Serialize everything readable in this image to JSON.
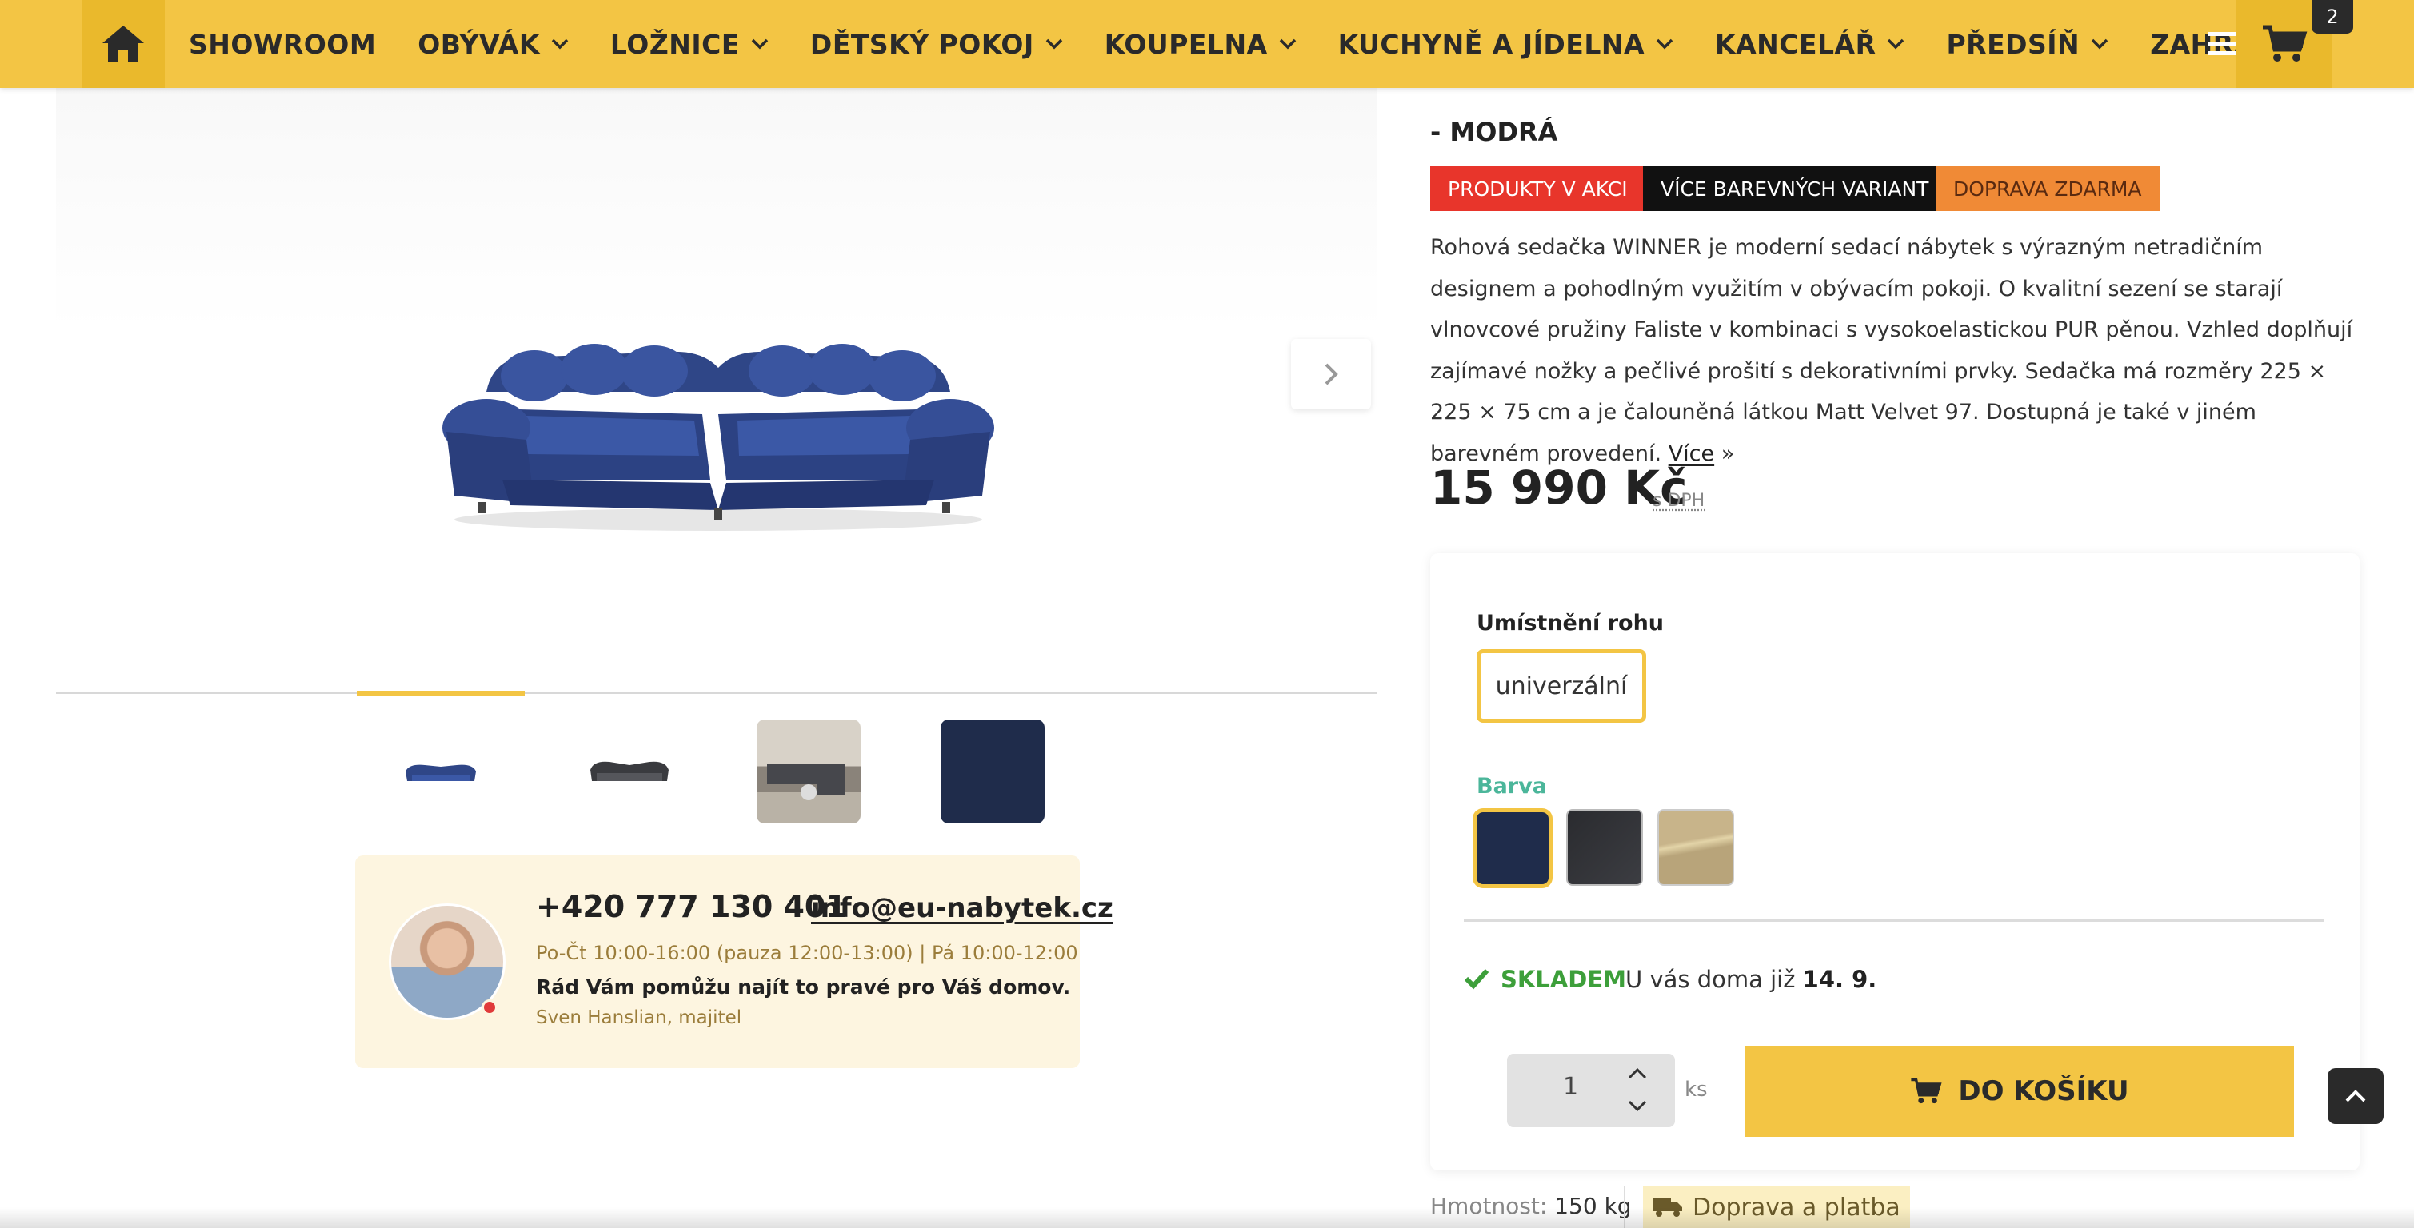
{
  "nav": {
    "items": [
      {
        "label": "SHOWROOM",
        "dropdown": false
      },
      {
        "label": "OBÝVÁK",
        "dropdown": true
      },
      {
        "label": "LOŽNICE",
        "dropdown": true
      },
      {
        "label": "DĚTSKÝ POKOJ",
        "dropdown": true
      },
      {
        "label": "KOUPELNA",
        "dropdown": true
      },
      {
        "label": "KUCHYNĚ A JÍDELNA",
        "dropdown": true
      },
      {
        "label": "KANCELÁŘ",
        "dropdown": true
      },
      {
        "label": "PŘEDSÍŇ",
        "dropdown": true
      },
      {
        "label": "ZAHRADA",
        "dropdown": true
      }
    ],
    "cart_count": "2"
  },
  "product": {
    "subtitle": "- MODRÁ",
    "tags": [
      {
        "label": "PRODUKTY V AKCI",
        "color": "#e8352b"
      },
      {
        "label": "VÍCE BAREVNÝCH VARIANT",
        "color": "#111111"
      },
      {
        "label": "DOPRAVA ZDARMA",
        "color": "#f08a36"
      }
    ],
    "description": "Rohová sedačka WINNER je moderní sedací nábytek s výrazným netradičním designem a pohodlným využitím v obývacím pokoji. O kvalitní sezení se starají vlnovcové pružiny Faliste v kombinaci s vysokoelastickou PUR pěnou. Vzhled doplňují zajímavé nožky a pečlivé prošití s dekorativními prvky. Sedačka má rozměry 225 × 225 × 75 cm a je čalouněná látkou Matt Velvet 97. Dostupná je také v jiném barevném provedení.",
    "more_link": "Více",
    "price": "15 990 Kč",
    "price_note": "s DPH"
  },
  "options": {
    "corner_label": "Umístnění rohu",
    "corner_value": "univerzální",
    "color_label": "Barva",
    "swatches": [
      "#1f2c4b",
      "#2e2f33",
      "#c8b48a"
    ]
  },
  "stock": {
    "status": "SKLADEM",
    "delivery_text": "U vás doma již",
    "delivery_date": "14. 9."
  },
  "purchase": {
    "quantity": "1",
    "unit": "ks",
    "add_to_cart": "DO KOŠÍKU"
  },
  "footer_info": {
    "weight_label": "Hmotnost:",
    "weight_value": "150 kg",
    "shipping_label": "Doprava a platba"
  },
  "contact": {
    "phone": "+420 777 130 401",
    "email": "info@eu-nabytek.cz",
    "hours": "Po-Čt 10:00-16:00 (pauza 12:00-13:00) | Pá 10:00-12:00",
    "message": "Rád Vám pomůžu najít to pravé pro Váš domov.",
    "signature": "Sven Hanslian, majitel"
  },
  "colors": {
    "brand_yellow": "#f3c544",
    "stock_green": "#3d9f3a",
    "color_label_teal": "#4bb69a"
  }
}
